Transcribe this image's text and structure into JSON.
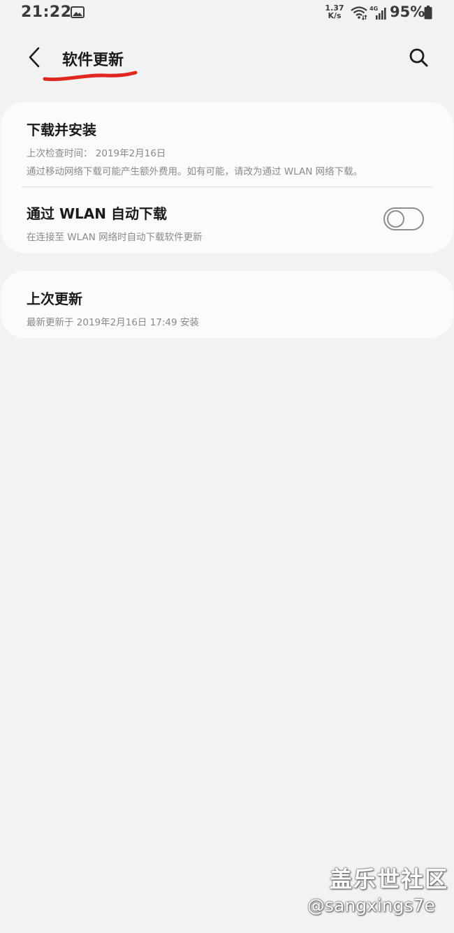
{
  "status_bar": {
    "time": "21:22",
    "net_speed_value": "1.37",
    "net_speed_unit": "K/s",
    "network_type": "4G",
    "battery": "95%"
  },
  "header": {
    "title": "软件更新",
    "annotation_color": "#e0271f"
  },
  "download_card": {
    "title": "下载并安装",
    "last_check": "上次检查时间： 2019年2月16日",
    "notice": "通过移动网络下载可能产生额外费用。如有可能，请改为通过 WLAN 网络下载。",
    "auto_title": "通过 WLAN 自动下载",
    "auto_desc": "在连接至 WLAN 网络时自动下载软件更新",
    "auto_toggle_on": false
  },
  "last_update_card": {
    "title": "上次更新",
    "desc": "最新更新于 2019年2月16日 17:49 安装"
  },
  "watermark": {
    "title": "盖乐世社区",
    "handle": "@sangxings7e"
  }
}
